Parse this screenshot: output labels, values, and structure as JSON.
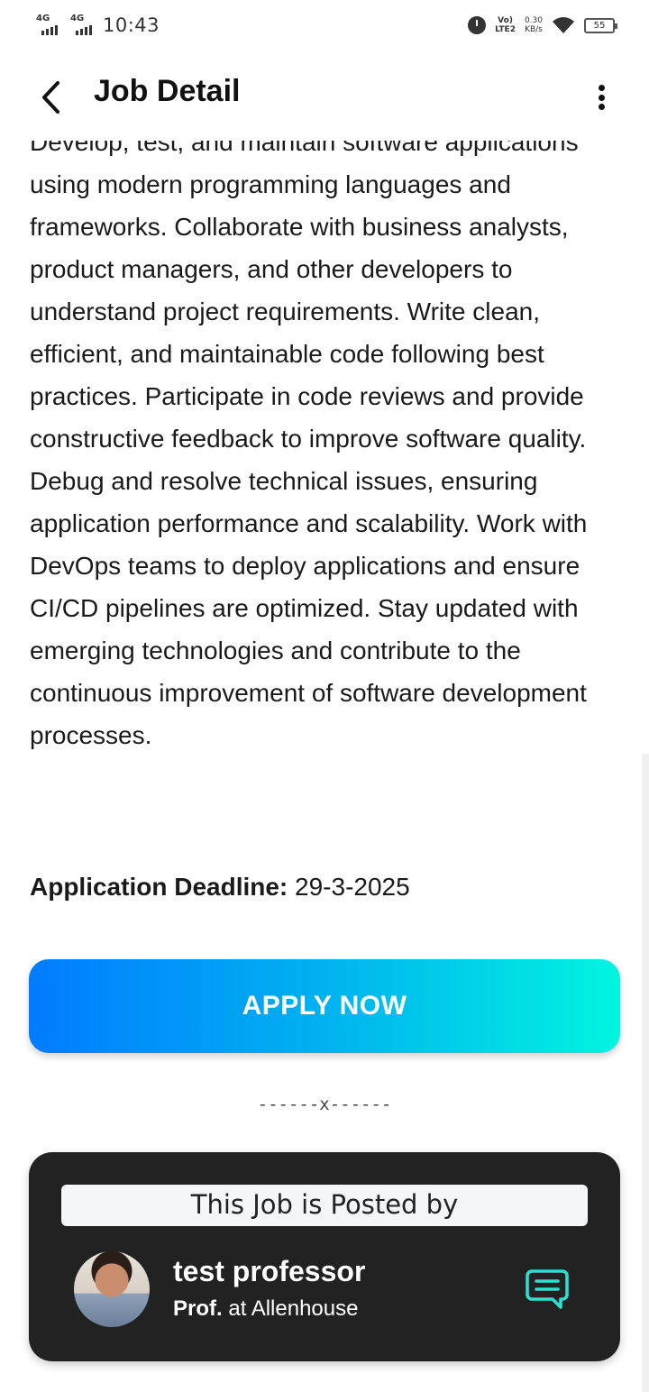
{
  "status_bar": {
    "sim1": "4G",
    "sim2": "4G",
    "time": "10:43",
    "volte_line1": "Vo)",
    "volte_line2": "LTE2",
    "speed_value": "0.30",
    "speed_unit": "KB/s",
    "battery": "55"
  },
  "header": {
    "title": "Job Detail"
  },
  "job": {
    "description": "Develop, test, and maintain software applications using modern programming languages and frameworks. Collaborate with business analysts, product managers, and other developers to understand project requirements. Write clean, efficient, and maintainable code following best practices. Participate in code reviews and provide constructive feedback to improve software quality. Debug and resolve technical issues, ensuring application performance and scalability. Work with DevOps teams to deploy applications and ensure CI/CD pipelines are optimized. Stay updated with emerging technologies and contribute to the continuous improvement of software development processes.",
    "deadline_label": "Application Deadline:",
    "deadline_value": "29-3-2025",
    "apply_label": "APPLY NOW",
    "divider": "------x------"
  },
  "poster": {
    "heading": "This Job is Posted by",
    "name": "test professor",
    "role_title": "Prof.",
    "role_rest": "at Allenhouse"
  },
  "icons": {
    "back": "chevron-left-icon",
    "menu": "more-vertical-icon",
    "chat": "chat-bubble-icon"
  },
  "colors": {
    "apply_gradient_start": "#007bff",
    "apply_gradient_end": "#00f5e0",
    "card_background": "#222222",
    "chat_icon": "#2de0d2"
  }
}
